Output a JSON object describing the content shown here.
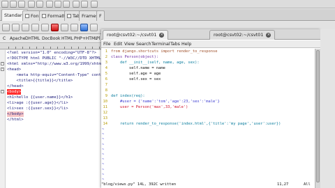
{
  "editor": {
    "tabs": [
      {
        "label": "Standard",
        "active": true
      },
      {
        "label": "Fonts",
        "active": false
      },
      {
        "label": "Formatting",
        "active": false
      },
      {
        "label": "Tables",
        "active": false
      },
      {
        "label": "Frames",
        "active": false
      },
      {
        "label": "F",
        "active": false
      }
    ],
    "lang_items": [
      "C",
      "Apache",
      "DHTML",
      "DocBook",
      "HTML",
      "PHP+HTML",
      "Pl"
    ],
    "lines": [
      "<?xml version=\"1.0\" encoding=\"UTF-8\"?>",
      "<!DOCTYPE html PUBLIC \"-//W3C//DTD XHTML 1",
      "<html xmlns=\"http://www.w3.org/1999/xhtml\"",
      "<head>",
      "    <meta http-equiv=\"Content-Type\" content",
      "    <title>{{title}}</title>",
      "</head>",
      "<body>",
      "<h1>hello {{user.name}}</h1>",
      "<li>age :{{user.age}}</li>",
      "<li>sex :{{user.sex}}</li>",
      "</body>",
      "</html>"
    ]
  },
  "terminal": {
    "tabs": [
      {
        "label": "root@csvt02:~/csvt01",
        "active": true
      },
      {
        "label": "root@csvt02:~/csvt01",
        "active": false
      }
    ],
    "menu": [
      "File",
      "Edit",
      "View",
      "Search",
      "Terminal",
      "Tabs",
      "Help"
    ],
    "line_numbers": [
      "1",
      "2",
      "3",
      "4",
      "5",
      "6",
      "7",
      "8",
      "9",
      "10",
      "11",
      "12",
      "13",
      "14"
    ],
    "code_lines": [
      "from django.shortcuts import render_to_response",
      "class Person(object):",
      "    def __init__(self, name, age, sex):",
      "        self.name = name",
      "        self.age = age",
      "        self.sex = sex",
      "",
      "",
      "def index(req):",
      "    #user = {'name':'tom','age':23,'sex':'male'}",
      "    user = Person('max',33,'male')",
      "",
      "",
      "    return render_to_response('index.html',{'title':'my page','user':user})"
    ],
    "tilde_count": 11,
    "status": {
      "message": "\"blog/views.py\" 14L, 392C written",
      "position": "11,27",
      "scroll": "All"
    }
  }
}
